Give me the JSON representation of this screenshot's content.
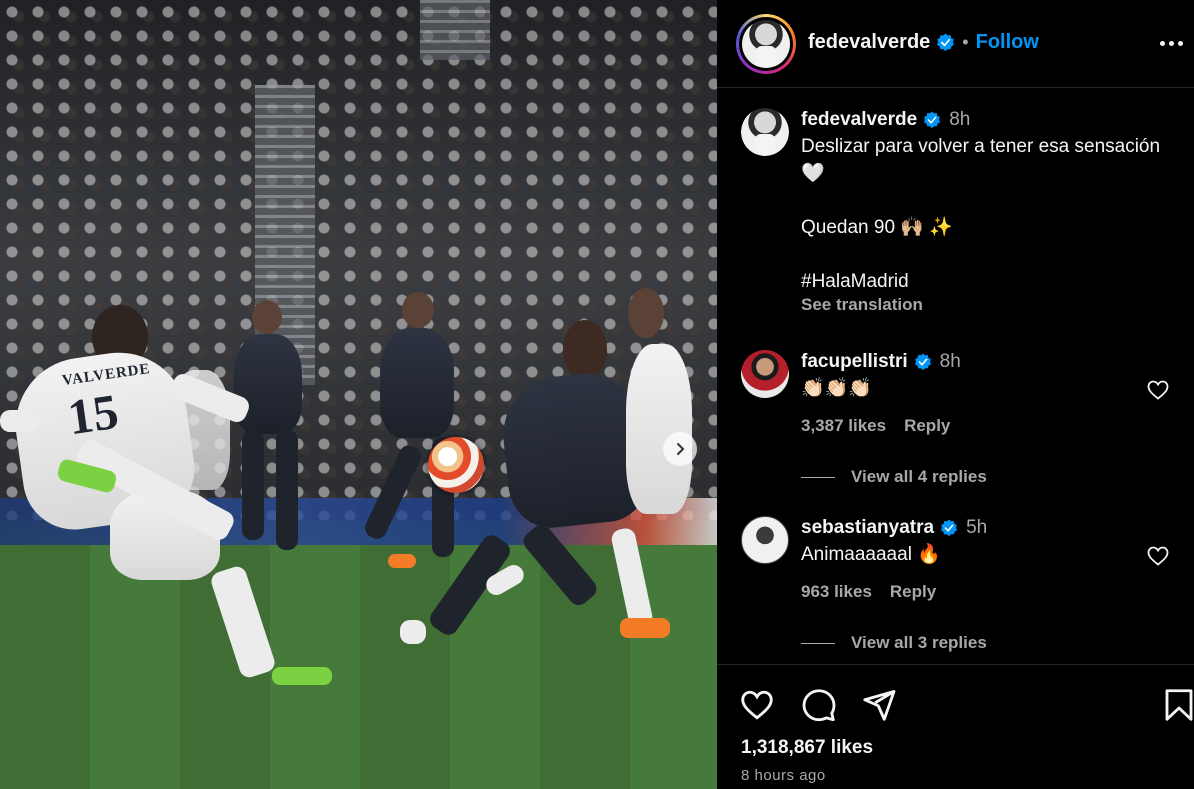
{
  "post": {
    "username": "fedevalverde",
    "follow_label": "Follow",
    "separator": "•",
    "photo": {
      "shirt_name": "VALVERDE",
      "shirt_number": "15"
    }
  },
  "caption": {
    "username": "fedevalverde",
    "time": "8h",
    "line1": "Deslizar para volver a tener esa sensación 🤍",
    "line2": "Quedan 90 🙌🏼 ✨",
    "line3": "#HalaMadrid",
    "see_translation": "See translation"
  },
  "comments": [
    {
      "username": "facupellistri",
      "time": "8h",
      "text": "👏🏻👏🏻👏🏻",
      "likes": "3,387 likes",
      "reply_label": "Reply",
      "view_replies": "View all 4 replies"
    },
    {
      "username": "sebastianyatra",
      "time": "5h",
      "text": "Animaaaaaal 🔥",
      "likes": "963 likes",
      "reply_label": "Reply",
      "view_replies": "View all 3 replies"
    }
  ],
  "footer": {
    "likes": "1,318,867 likes",
    "time_ago": "8 hours ago"
  },
  "colors": {
    "accent": "#0095f6",
    "verified": "#0095f6",
    "muted": "#a8a8a8",
    "background": "#000000"
  },
  "icons": [
    "verified-icon",
    "more-icon",
    "heart-icon",
    "comment-icon",
    "share-icon",
    "bookmark-icon",
    "chevron-right-icon"
  ]
}
